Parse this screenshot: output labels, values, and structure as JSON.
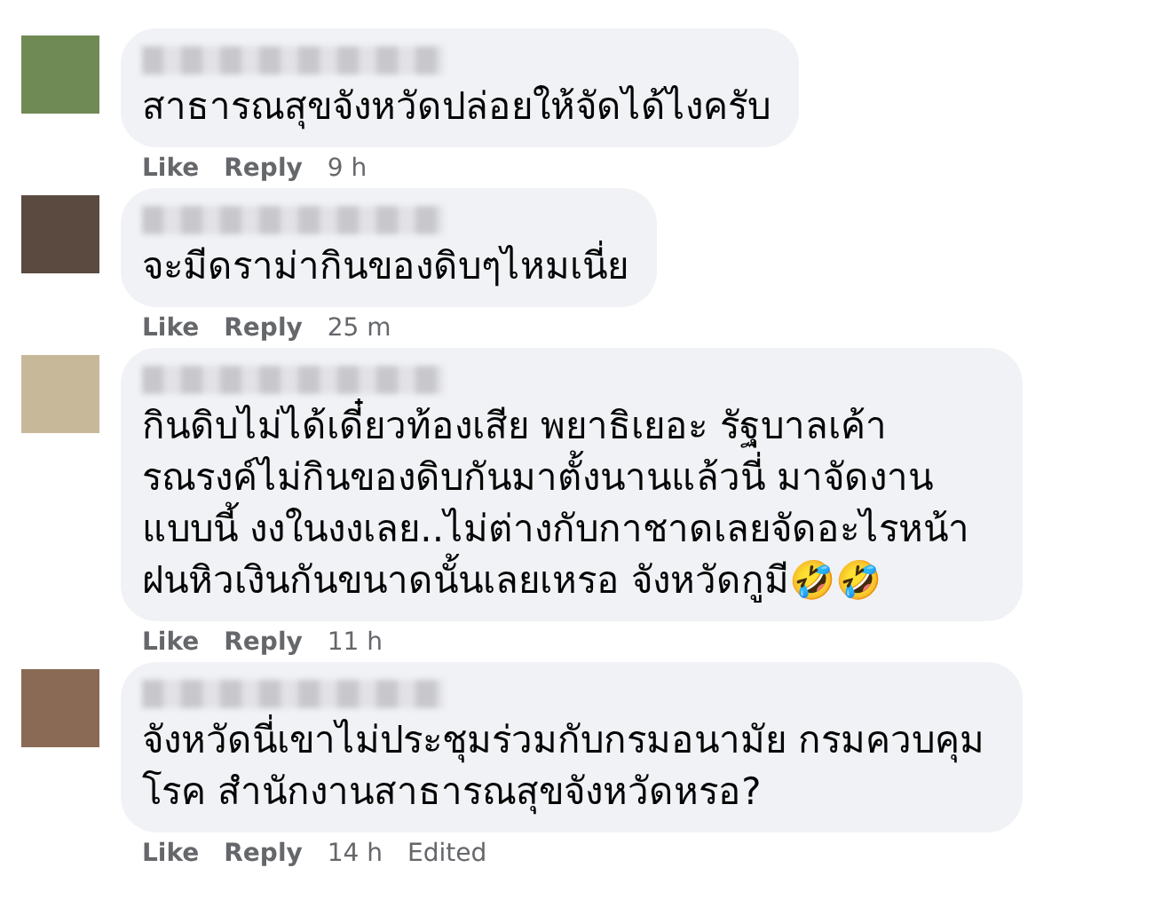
{
  "comments": [
    {
      "text": "สาธารณสุขจังหวัดปล่อยให้จัดได้ไงครับ",
      "color": "#6f8a55",
      "actions": {
        "like": "Like",
        "reply": "Reply",
        "time": "9 h"
      }
    },
    {
      "text": "จะมีดราม่ากินของดิบๆไหมเนี่ย",
      "color": "#5a4a40",
      "actions": {
        "like": "Like",
        "reply": "Reply",
        "time": "25 m"
      }
    },
    {
      "text": "กินดิบไม่ได้เดี๋ยวท้องเสีย พยาธิเยอะ รัฐบาลเค้ารณรงค์ไม่กินของดิบกันมาตั้งนานแล้วนี่ มาจัดงานแบบนี้ งงในงงเลย..ไม่ต่างกับกาชาดเลยจัดอะไรหน้าฝนหิวเงินกันขนาดนั้นเลยเหรอ จังหวัดกูมี🤣🤣",
      "color": "#c8b89a",
      "actions": {
        "like": "Like",
        "reply": "Reply",
        "time": "11 h"
      }
    },
    {
      "text": "จังหวัดนี่เขาไม่ประชุมร่วมกับกรมอนามัย กรมควบคุมโรค สำนักงานสาธารณสุขจังหวัดหรอ?",
      "color": "#8a6a55",
      "actions": {
        "like": "Like",
        "reply": "Reply",
        "time": "14 h",
        "edited": "Edited"
      }
    }
  ]
}
